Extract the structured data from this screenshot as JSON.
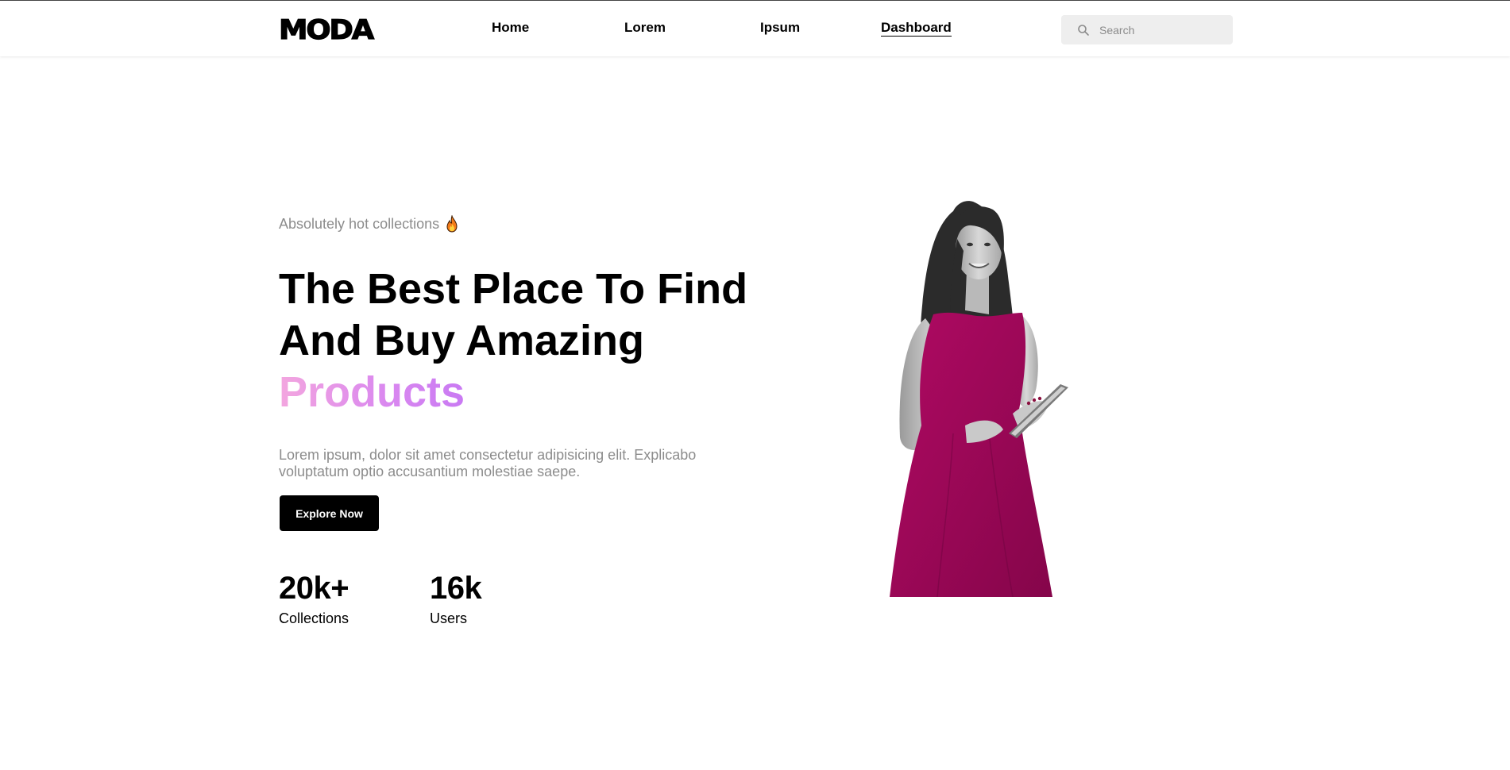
{
  "header": {
    "logo": "MODA",
    "nav": [
      {
        "label": "Home"
      },
      {
        "label": "Lorem"
      },
      {
        "label": "Ipsum"
      },
      {
        "label": "Dashboard"
      }
    ],
    "search": {
      "placeholder": "Search",
      "value": "",
      "icon": "search-icon"
    }
  },
  "hero": {
    "tagline": "Absolutely hot collections",
    "tagline_icon": "fire-icon",
    "headline_plain": "The Best Place To Find And Buy Amazing",
    "headline_accent": "Products",
    "description": "Lorem ipsum, dolor sit amet consectetur adipisicing elit. Explicabo voluptatum optio accusantium molestiae saepe.",
    "cta_label": "Explore Now",
    "stats": [
      {
        "value": "20k+",
        "label": "Collections"
      },
      {
        "value": "16k",
        "label": "Users"
      }
    ],
    "image": "woman-in-magenta-dress-holding-tablet"
  },
  "colors": {
    "accent_gradient_start": "#f3a6df",
    "accent_gradient_end": "#c97af3",
    "dress": "#a0085a",
    "button": "#000000",
    "muted_text": "#8c8c8c",
    "search_bg": "#eeeeee"
  }
}
